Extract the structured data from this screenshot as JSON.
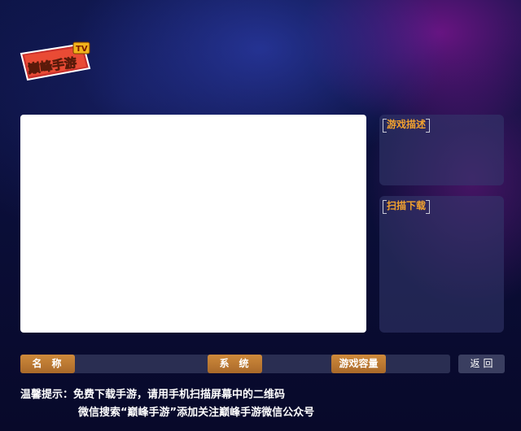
{
  "logo": {
    "text": "巅峰手游",
    "badge": "TV"
  },
  "panels": {
    "description_title": "游戏描述",
    "download_title": "扫描下载"
  },
  "info_bar": {
    "name_label": "名称",
    "system_label": "系统",
    "capacity_label": "游戏容量"
  },
  "back_button": "返回",
  "tips": {
    "line1": "温馨提示：免费下载手游，请用手机扫描屏幕中的二维码",
    "line2": "微信搜索“巅峰手游”添加关注巅峰手游微信公众号"
  },
  "colors": {
    "accent_orange": "#f2a22e",
    "tag_bg": "#cf8a3b",
    "background": "#0a0d35"
  }
}
